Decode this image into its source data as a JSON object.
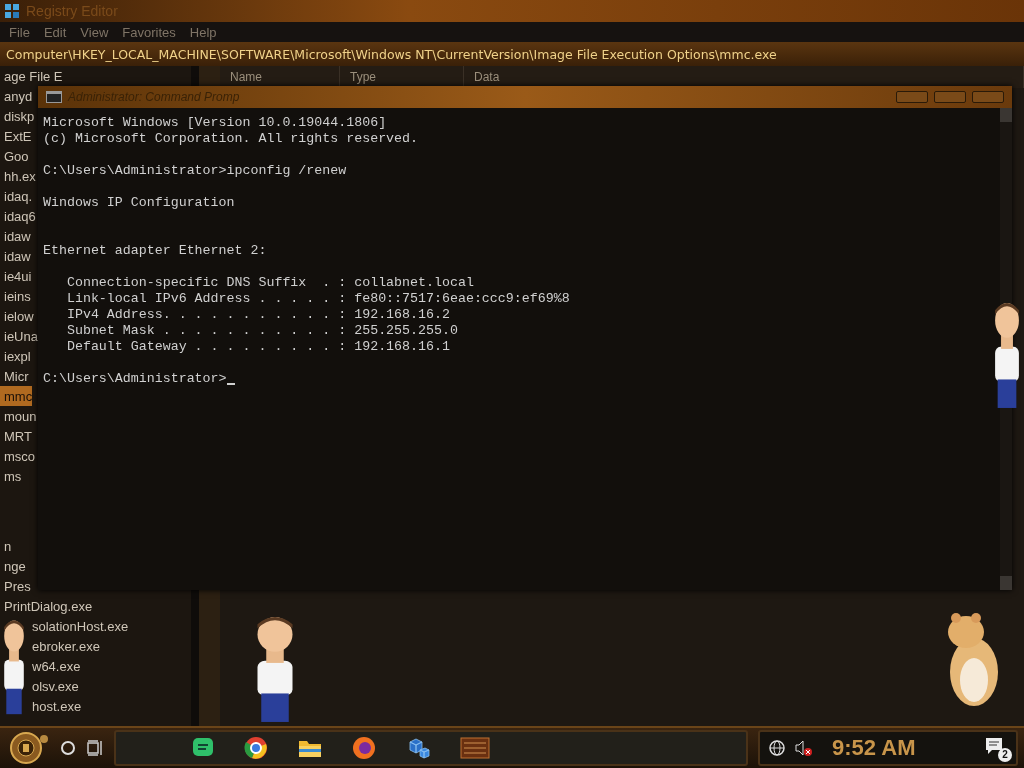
{
  "registry": {
    "title": "Registry Editor",
    "menu": [
      "File",
      "Edit",
      "View",
      "Favorites",
      "Help"
    ],
    "address": "Computer\\HKEY_LOCAL_MACHINE\\SOFTWARE\\Microsoft\\Windows NT\\CurrentVersion\\Image File Execution Options\\mmc.exe",
    "keys": [
      {
        "label": "age File E",
        "selected": false
      },
      {
        "label": "anyd",
        "selected": false
      },
      {
        "label": "diskp",
        "selected": false
      },
      {
        "label": "ExtE",
        "selected": false
      },
      {
        "label": "Goo",
        "selected": false
      },
      {
        "label": "hh.ex",
        "selected": false
      },
      {
        "label": "idaq.",
        "selected": false
      },
      {
        "label": "idaq6",
        "selected": false
      },
      {
        "label": "idaw",
        "selected": false
      },
      {
        "label": "idaw",
        "selected": false
      },
      {
        "label": "ie4ui",
        "selected": false
      },
      {
        "label": "ieins",
        "selected": false
      },
      {
        "label": "ielow",
        "selected": false
      },
      {
        "label": "ieUna",
        "selected": false
      },
      {
        "label": "iexpl",
        "selected": false
      },
      {
        "label": "Micr",
        "selected": false
      },
      {
        "label": "mmc",
        "selected": true
      },
      {
        "label": "moun",
        "selected": false
      },
      {
        "label": "MRT",
        "selected": false
      },
      {
        "label": "msco",
        "selected": false
      },
      {
        "label": "ms",
        "selected": false
      }
    ],
    "keys_lower": [
      {
        "label": "n",
        "selected": false
      },
      {
        "label": "nge",
        "selected": false
      },
      {
        "label": "Pres",
        "selected": false
      },
      {
        "label": "PrintDialog.exe",
        "selected": false
      }
    ],
    "keys_beside_figure": [
      {
        "label": "solationHost.exe",
        "selected": false
      },
      {
        "label": "ebroker.exe",
        "selected": false
      },
      {
        "label": "w64.exe",
        "selected": false
      },
      {
        "label": "olsv.exe",
        "selected": false
      },
      {
        "label": "host.exe",
        "selected": false
      }
    ],
    "columns": [
      "Name",
      "Type",
      "Data"
    ]
  },
  "cmd": {
    "title": "Administrator: Command Promp",
    "lines": [
      {
        "kind": "text",
        "text": "Microsoft Windows [Version 10.0.19044.1806]"
      },
      {
        "kind": "text",
        "text": "(c) Microsoft Corporation. All rights reserved."
      },
      {
        "kind": "blank"
      },
      {
        "kind": "text",
        "text": "C:\\Users\\Administrator>ipconfig /renew"
      },
      {
        "kind": "blank"
      },
      {
        "kind": "text",
        "text": "Windows IP Configuration"
      },
      {
        "kind": "blank"
      },
      {
        "kind": "blank"
      },
      {
        "kind": "text",
        "text": "Ethernet adapter Ethernet 2:"
      },
      {
        "kind": "blank"
      },
      {
        "kind": "text",
        "text": "   Connection-specific DNS Suffix  . : collabnet.local"
      },
      {
        "kind": "text",
        "text": "   Link-local IPv6 Address . . . . . : fe80::7517:6eae:ccc9:ef69%8"
      },
      {
        "kind": "text",
        "text": "   IPv4 Address. . . . . . . . . . . : 192.168.16.2"
      },
      {
        "kind": "text",
        "text": "   Subnet Mask . . . . . . . . . . . : 255.255.255.0"
      },
      {
        "kind": "text",
        "text": "   Default Gateway . . . . . . . . . : 192.168.16.1"
      },
      {
        "kind": "blank"
      },
      {
        "kind": "prompt",
        "text": "C:\\Users\\Administrator>"
      }
    ]
  },
  "taskbar": {
    "clock": "9:52 AM",
    "notification_count": "2"
  }
}
